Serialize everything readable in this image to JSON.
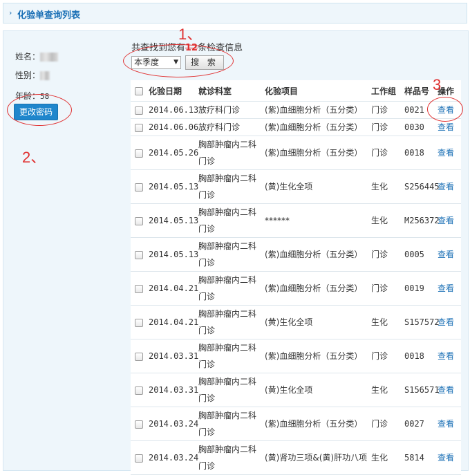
{
  "header": {
    "title": "化验单查询列表"
  },
  "patient": {
    "name_label": "姓名：",
    "gender_label": "性别：",
    "age_label": "年龄：",
    "age_value": "58",
    "change_password_label": "更改密码"
  },
  "summary": {
    "prefix": "共查找到您有",
    "count": "12",
    "suffix": "条检查信息"
  },
  "filter": {
    "period": "本季度",
    "search_label": "搜 索"
  },
  "table": {
    "columns": [
      "化验日期",
      "就诊科室",
      "化验项目",
      "工作组",
      "样品号",
      "操作"
    ],
    "action_label": "查看",
    "rows": [
      {
        "date": "2014.06.13",
        "dept": "放疗科门诊",
        "item": "(紫)血细胞分析（五分类）",
        "group": "门诊",
        "sample": "0021"
      },
      {
        "date": "2014.06.06",
        "dept": "放疗科门诊",
        "item": "(紫)血细胞分析（五分类）",
        "group": "门诊",
        "sample": "0030"
      },
      {
        "date": "2014.05.26",
        "dept": "胸部肿瘤内二科门诊",
        "item": "(紫)血细胞分析（五分类）",
        "group": "门诊",
        "sample": "0018"
      },
      {
        "date": "2014.05.13",
        "dept": "胸部肿瘤内二科门诊",
        "item": "(黄)生化全项",
        "group": "生化",
        "sample": "S256445"
      },
      {
        "date": "2014.05.13",
        "dept": "胸部肿瘤内二科门诊",
        "item": "******",
        "group": "生化",
        "sample": "M256372"
      },
      {
        "date": "2014.05.13",
        "dept": "胸部肿瘤内二科门诊",
        "item": "(紫)血细胞分析（五分类）",
        "group": "门诊",
        "sample": "0005"
      },
      {
        "date": "2014.04.21",
        "dept": "胸部肿瘤内二科门诊",
        "item": "(紫)血细胞分析（五分类）",
        "group": "门诊",
        "sample": "0019"
      },
      {
        "date": "2014.04.21",
        "dept": "胸部肿瘤内二科门诊",
        "item": "(黄)生化全项",
        "group": "生化",
        "sample": "S157572"
      },
      {
        "date": "2014.03.31",
        "dept": "胸部肿瘤内二科门诊",
        "item": "(紫)血细胞分析（五分类）",
        "group": "门诊",
        "sample": "0018"
      },
      {
        "date": "2014.03.31",
        "dept": "胸部肿瘤内二科门诊",
        "item": "(黄)生化全项",
        "group": "生化",
        "sample": "S156571"
      },
      {
        "date": "2014.03.24",
        "dept": "胸部肿瘤内二科门诊",
        "item": "(紫)血细胞分析（五分类）",
        "group": "门诊",
        "sample": "0027"
      },
      {
        "date": "2014.03.24",
        "dept": "胸部肿瘤内二科门诊",
        "item": "(黄)肾功三项&(黄)肝功八项",
        "group": "生化",
        "sample": "5814"
      }
    ]
  },
  "annotations": {
    "one": "1、",
    "two": "2、",
    "three": "3"
  },
  "colors": {
    "accent": "#1f86cc",
    "annotation": "#e03131",
    "panel_bg": "#eef6fb"
  }
}
